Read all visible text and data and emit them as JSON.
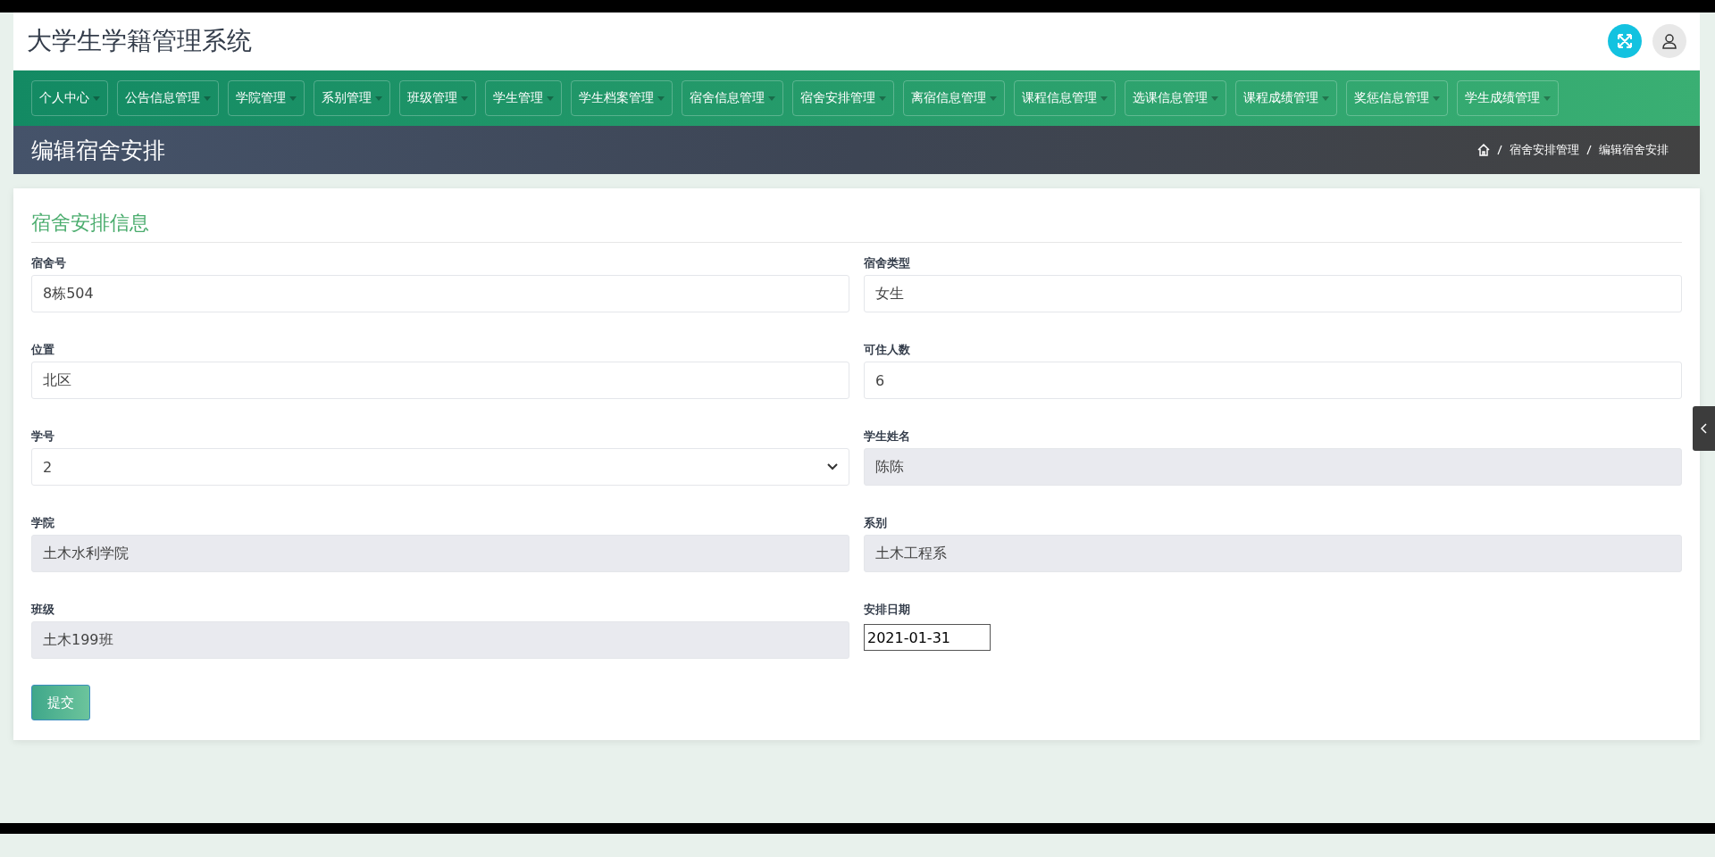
{
  "header": {
    "title": "大学生学籍管理系统"
  },
  "nav": [
    {
      "label": "个人中心"
    },
    {
      "label": "公告信息管理"
    },
    {
      "label": "学院管理"
    },
    {
      "label": "系别管理"
    },
    {
      "label": "班级管理"
    },
    {
      "label": "学生管理"
    },
    {
      "label": "学生档案管理"
    },
    {
      "label": "宿舍信息管理"
    },
    {
      "label": "宿舍安排管理"
    },
    {
      "label": "离宿信息管理"
    },
    {
      "label": "课程信息管理"
    },
    {
      "label": "选课信息管理"
    },
    {
      "label": "课程成绩管理"
    },
    {
      "label": "奖惩信息管理"
    },
    {
      "label": "学生成绩管理"
    }
  ],
  "page_title": "编辑宿舍安排",
  "breadcrumb": [
    "宿舍安排管理",
    "编辑宿舍安排"
  ],
  "card": {
    "title": "宿舍安排信息",
    "fields": [
      {
        "label": "宿舍号",
        "value": "8栋504",
        "kind": "text"
      },
      {
        "label": "宿舍类型",
        "value": "女生",
        "kind": "text"
      },
      {
        "label": "位置",
        "value": "北区",
        "kind": "text"
      },
      {
        "label": "可住人数",
        "value": "6",
        "kind": "text"
      },
      {
        "label": "学号",
        "value": "2",
        "kind": "select"
      },
      {
        "label": "学生姓名",
        "value": "陈陈",
        "kind": "readonly"
      },
      {
        "label": "学院",
        "value": "土木水利学院",
        "kind": "readonly"
      },
      {
        "label": "系别",
        "value": "土木工程系",
        "kind": "readonly"
      },
      {
        "label": "班级",
        "value": "土木199班",
        "kind": "readonly"
      },
      {
        "label": "安排日期",
        "value": "2021-01-31",
        "kind": "date"
      }
    ],
    "submit": "提交"
  }
}
